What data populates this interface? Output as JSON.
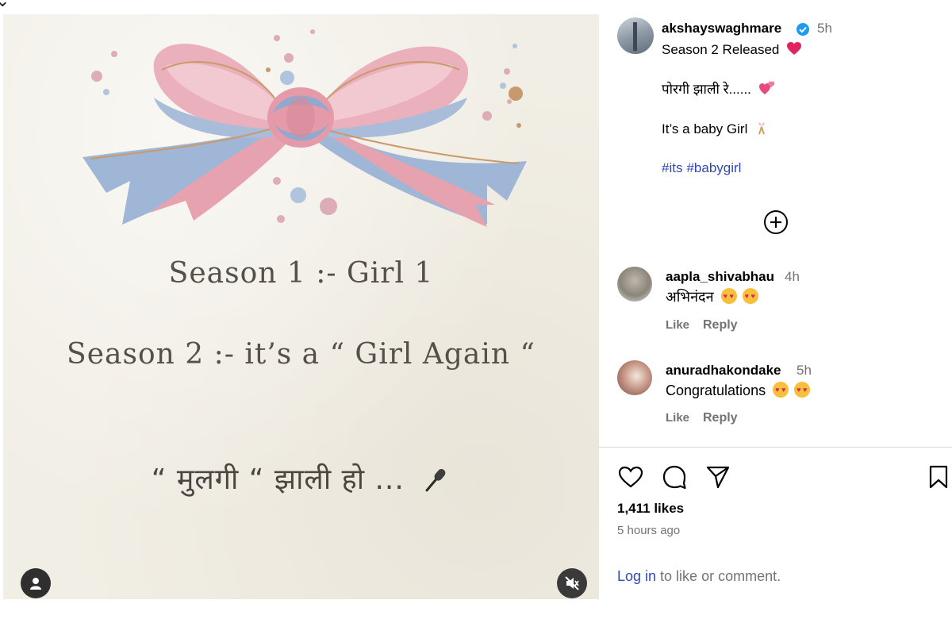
{
  "post": {
    "username": "akshayswaghmare",
    "time": "5h",
    "caption_line1": "Season 2 Released",
    "caption_line2": "पोरगी झाली रे......",
    "caption_line3": "It’s a baby Girl",
    "hashtags": [
      "#its",
      "#babygirl"
    ]
  },
  "media": {
    "line1": "Season 1 :- Girl 1",
    "line2": "Season 2 :- it’s a  “ Girl Again “",
    "line3": "“ मुलगी “  झाली   हो ..."
  },
  "comments": [
    {
      "username": "aapla_shivabhau",
      "time": "4h",
      "text": "अभिनंदन",
      "like_label": "Like",
      "reply_label": "Reply"
    },
    {
      "username": "anuradhakondake",
      "time": "5h",
      "text": "Congratulations",
      "like_label": "Like",
      "reply_label": "Reply"
    }
  ],
  "actions": {
    "likes": "1,411 likes",
    "time_ago": "5 hours ago",
    "login_link": "Log in",
    "login_rest": " to like or comment."
  },
  "colors": {
    "link": "#2f49b8",
    "secondary_text": "#737373",
    "verified": "#1d9bf0",
    "bow_pink": "#e8a0ad",
    "bow_blue": "#9fb6d6",
    "background": "#f1eee5"
  },
  "icons": {
    "verified": "verified-badge-icon",
    "heart": "heart-icon",
    "comment": "comment-icon",
    "share": "share-icon",
    "bookmark": "bookmark-icon",
    "more": "plus-circle-icon",
    "mute": "muted-speaker-icon",
    "tag": "user-tag-icon",
    "mic": "microphone-icon"
  }
}
